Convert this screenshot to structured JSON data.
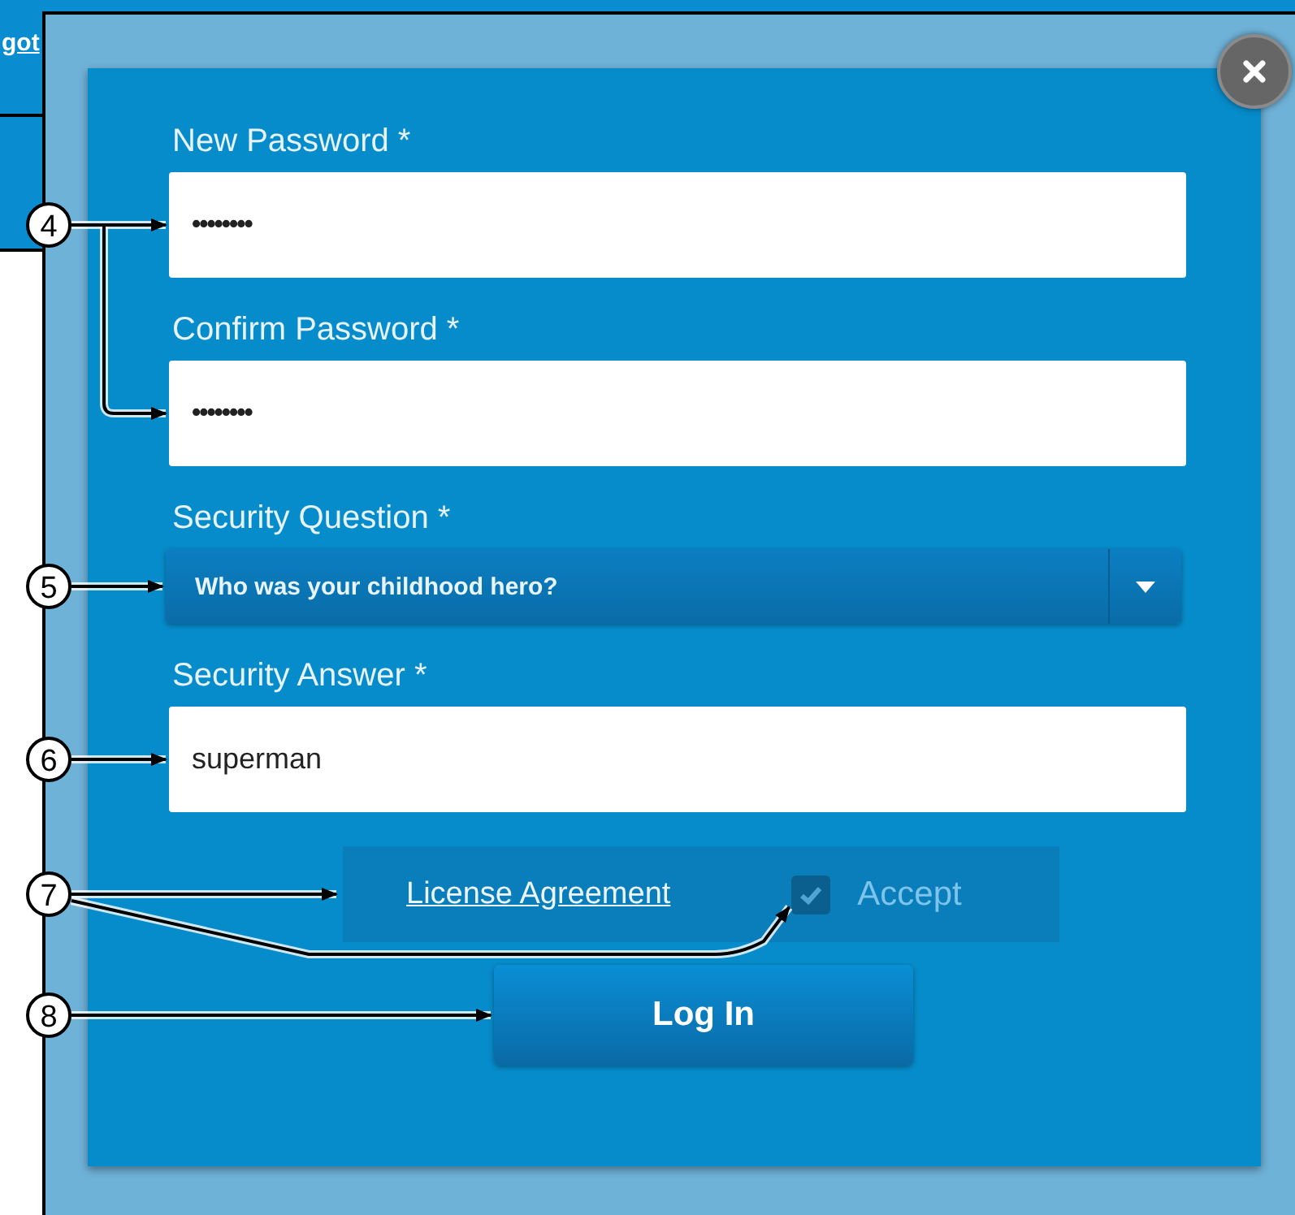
{
  "background": {
    "link": "got"
  },
  "dialog": {
    "fields": [
      {
        "kind": "password",
        "label": "New Password *",
        "value": "••••••••"
      },
      {
        "kind": "password",
        "label": "Confirm Password *",
        "value": "••••••••"
      },
      {
        "kind": "select",
        "label": "Security Question *",
        "value": "Who was your childhood hero?"
      },
      {
        "kind": "text",
        "label": "Security Answer *",
        "value": "superman"
      }
    ],
    "license": {
      "link": "License Agreement",
      "checkbox": {
        "label": "Accept",
        "checked": true,
        "disabled": true
      }
    },
    "submit": "Log In"
  },
  "callouts": [
    {
      "label": "4"
    },
    {
      "label": "5"
    },
    {
      "label": "6"
    },
    {
      "label": "7"
    },
    {
      "label": "8"
    }
  ]
}
